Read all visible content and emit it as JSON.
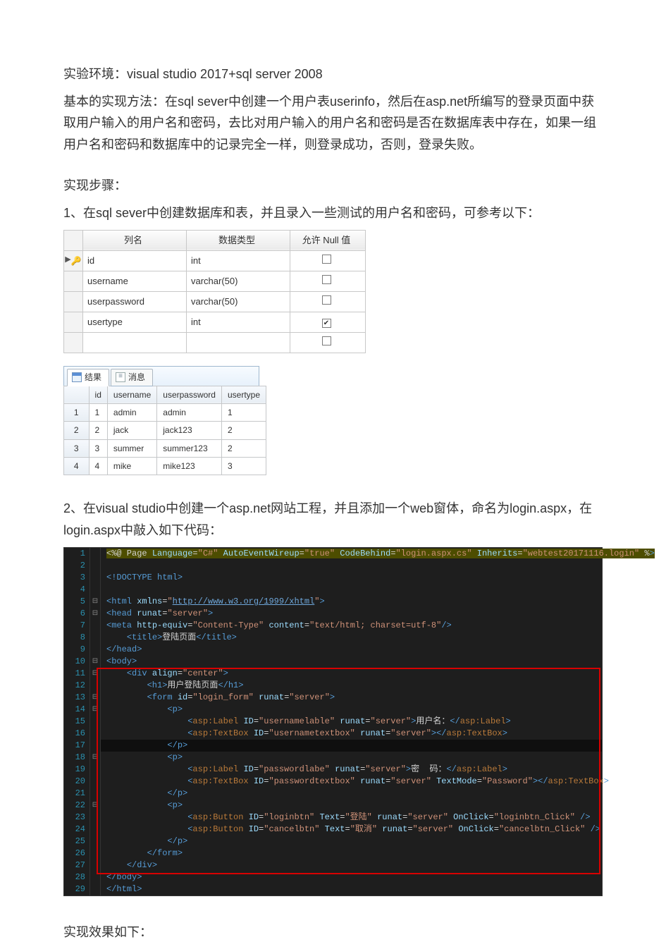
{
  "paragraphs": {
    "p1": "实验环境：visual studio 2017+sql server 2008",
    "p2": "基本的实现方法：在sql sever中创建一个用户表userinfo，然后在asp.net所编写的登录页面中获取用户输入的用户名和密码，去比对用户输入的用户名和密码是否在数据库表中存在，如果一组用户名和密码和数据库中的记录完全一样，则登录成功，否则，登录失败。",
    "p3": "实现步骤：",
    "p4": "1、在sql sever中创建数据库和表，并且录入一些测试的用户名和密码，可参考以下：",
    "p5": "2、在visual studio中创建一个asp.net网站工程，并且添加一个web窗体，命名为login.aspx，在login.aspx中敲入如下代码：",
    "p6": "实现效果如下："
  },
  "schema": {
    "headers": {
      "colname": "列名",
      "datatype": "数据类型",
      "allownull": "允许 Null 值"
    },
    "rows": [
      {
        "is_key": true,
        "name": "id",
        "type": "int",
        "null": false
      },
      {
        "is_key": false,
        "name": "username",
        "type": "varchar(50)",
        "null": false
      },
      {
        "is_key": false,
        "name": "userpassword",
        "type": "varchar(50)",
        "null": false
      },
      {
        "is_key": false,
        "name": "usertype",
        "type": "int",
        "null": true
      },
      {
        "is_key": false,
        "name": "",
        "type": "",
        "null": false
      }
    ]
  },
  "results": {
    "tabs": {
      "results": "结果",
      "messages": "消息"
    },
    "cols": [
      "id",
      "username",
      "userpassword",
      "usertype"
    ],
    "rows": [
      [
        1,
        "admin",
        "admin",
        "1"
      ],
      [
        2,
        "jack",
        "jack123",
        "2"
      ],
      [
        3,
        "summer",
        "summer123",
        "2"
      ],
      [
        4,
        "mike",
        "mike123",
        "3"
      ]
    ]
  },
  "code": {
    "lines": [
      "<%@ Page Language=\"C#\" AutoEventWireup=\"true\" CodeBehind=\"login.aspx.cs\" Inherits=\"webtest20171116.login\" %>",
      "",
      "<!DOCTYPE html>",
      "",
      "<html xmlns=\"http://www.w3.org/1999/xhtml\">",
      "<head runat=\"server\">",
      "<meta http-equiv=\"Content-Type\" content=\"text/html; charset=utf-8\"/>",
      "    <title>登陆页面</title>",
      "</head>",
      "<body>",
      "    <div align=\"center\">",
      "        <h1>用户登陆页面</h1>",
      "        <form id=\"login_form\" runat=\"server\">",
      "            <p>",
      "                <asp:Label ID=\"usernamelable\" runat=\"server\">用户名：</asp:Label>",
      "                <asp:TextBox ID=\"usernametextbox\" runat=\"server\"></asp:TextBox>",
      "            </p>",
      "            <p>",
      "                <asp:Label ID=\"passwordlabe\" runat=\"server\">密  码：</asp:Label>",
      "                <asp:TextBox ID=\"passwordtextbox\" runat=\"server\" TextMode=\"Password\"></asp:TextBox>",
      "            </p>",
      "            <p>",
      "                <asp:Button ID=\"loginbtn\" Text=\"登陆\" runat=\"server\" OnClick=\"loginbtn_Click\" />",
      "                <asp:Button ID=\"cancelbtn\" Text=\"取消\" runat=\"server\" OnClick=\"cancelbtn_Click\" />",
      "            </p>",
      "        </form>",
      "    </div>",
      "</body>",
      "</html>"
    ]
  }
}
